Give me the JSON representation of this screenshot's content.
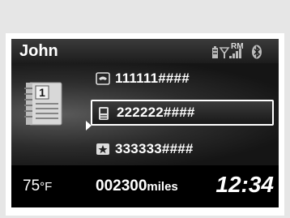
{
  "header": {
    "user_name": "John"
  },
  "status": {
    "roaming_label": "RM"
  },
  "phonebook": {
    "tab_label": "1",
    "entries": [
      {
        "icon": "phone-icon",
        "number": "111111####",
        "selected": false
      },
      {
        "icon": "mobile-icon",
        "number": "222222####",
        "selected": true
      },
      {
        "icon": "star-icon",
        "number": "333333####",
        "selected": false
      }
    ]
  },
  "footer": {
    "temperature": "75",
    "temperature_unit": "°F",
    "odometer": "002300",
    "odometer_unit": "miles",
    "clock": "12:34"
  }
}
